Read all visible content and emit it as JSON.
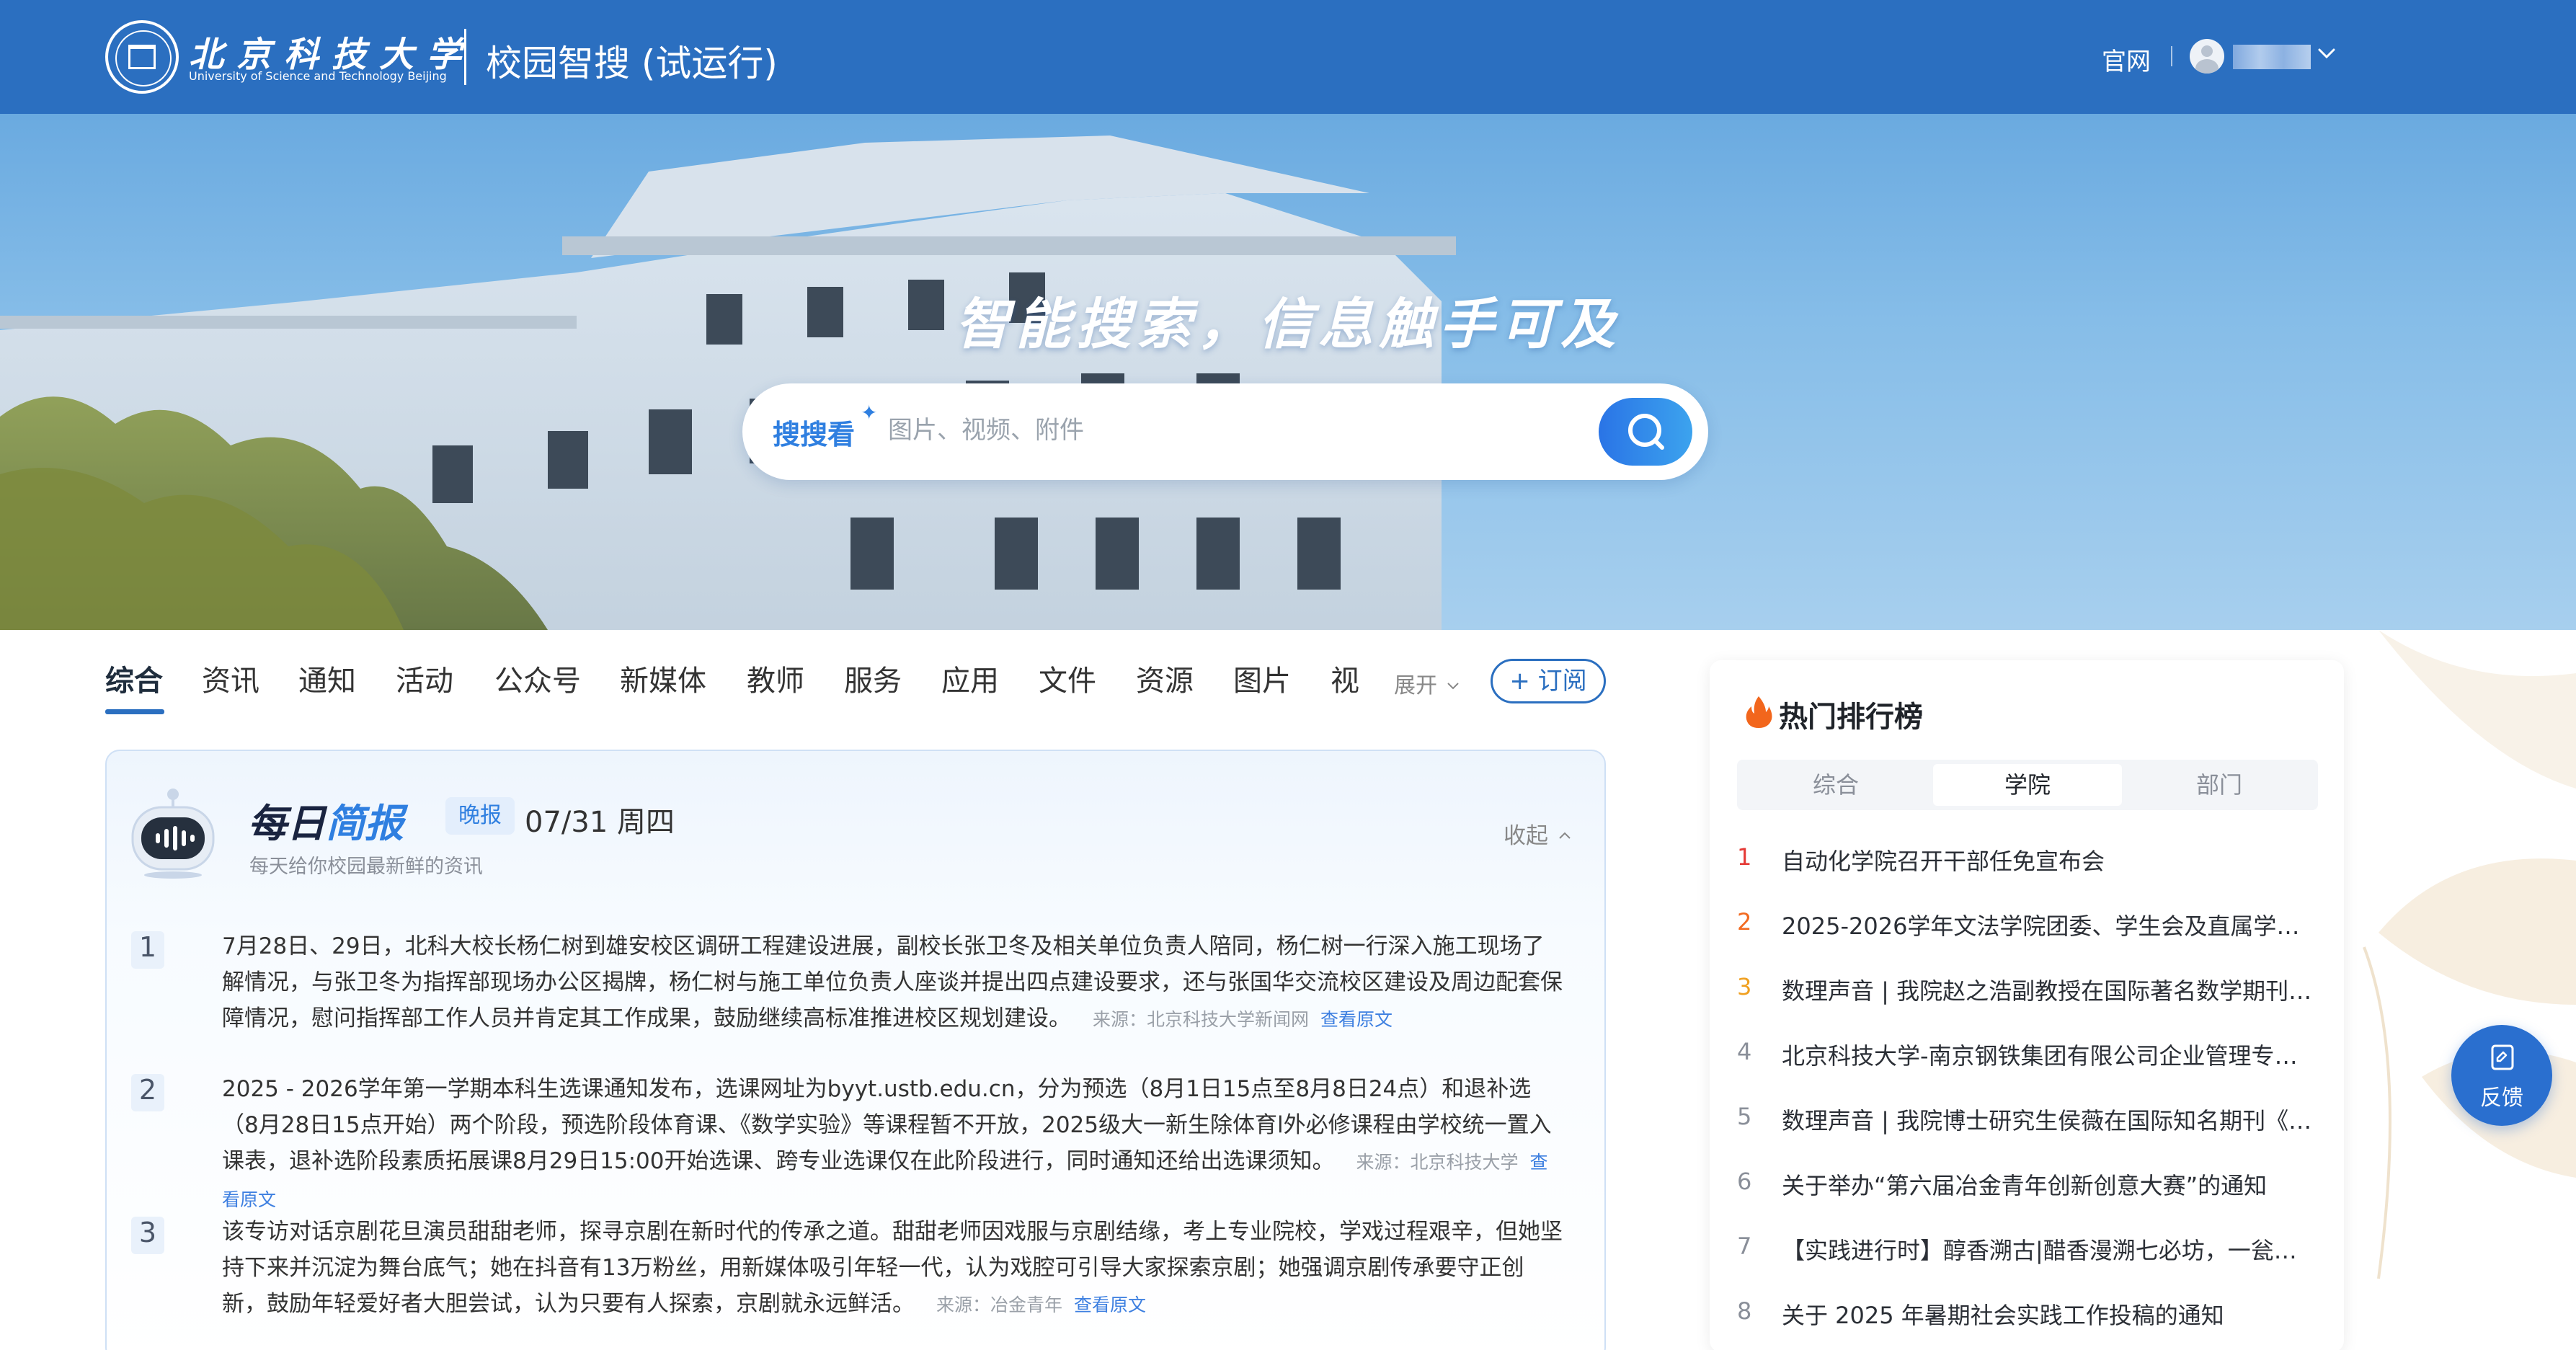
{
  "header": {
    "logo_cn": "北京科技大学",
    "logo_en": "University of Science and Technology Beijing",
    "app_title": "校园智搜 (试运行)",
    "official_site": "官网",
    "bg_color": "#2b6fc0"
  },
  "hero": {
    "slogan": "智能搜索，信息触手可及",
    "search_label": "搜搜看",
    "search_placeholder": "图片、视频、附件"
  },
  "tabs": {
    "items": [
      "综合",
      "资讯",
      "通知",
      "活动",
      "公众号",
      "新媒体",
      "教师",
      "服务",
      "应用",
      "文件",
      "资源",
      "图片",
      "视"
    ],
    "active": "综合",
    "expand_label": "展开",
    "subscribe_label": "+ 订阅"
  },
  "brief": {
    "title_part1": "每日",
    "title_part2": "简报",
    "badge": "晚报",
    "date": "07/31 周四",
    "subtitle": "每天给你校园最新鲜的资讯",
    "collapse_label": "收起",
    "items": [
      {
        "num": "1",
        "text": "7月28日、29日，北科大校长杨仁树到雄安校区调研工程建设进展，副校长张卫冬及相关单位负责人陪同，杨仁树一行深入施工现场了解情况，与张卫冬为指挥部现场办公区揭牌，杨仁树与施工单位负责人座谈并提出四点建设要求，还与张国华交流校区建设及周边配套保障情况，慰问指挥部工作人员并肯定其工作成果，鼓励继续高标准推进校区规划建设。",
        "source": "来源：北京科技大学新闻网",
        "link": "查看原文"
      },
      {
        "num": "2",
        "text": "2025 - 2026学年第一学期本科生选课通知发布，选课网址为byyt.ustb.edu.cn，分为预选（8月1日15点至8月8日24点）和退补选（8月28日15点开始）两个阶段，预选阶段体育课、《数学实验》等课程暂不开放，2025级大一新生除体育l外必修课程由学校统一置入课表，退补选阶段素质拓展课8月29日15:00开始选课、跨专业选课仅在此阶段进行，同时通知还给出选课须知。",
        "source": "来源：北京科技大学",
        "link": "查看原文"
      },
      {
        "num": "3",
        "text": "该专访对话京剧花旦演员甜甜老师，探寻京剧在新时代的传承之道。甜甜老师因戏服与京剧结缘，考上专业院校，学戏过程艰辛，但她坚持下来并沉淀为舞台底气；她在抖音有13万粉丝，用新媒体吸引年轻一代，认为戏腔可引导大家探索京剧；她强调京剧传承要守正创新，鼓励年轻爱好者大胆尝试，认为只要有人探索，京剧就永远鲜活。",
        "source": "来源：冶金青年",
        "link": "查看原文"
      }
    ]
  },
  "ranking": {
    "title": "热门排行榜",
    "tabs": [
      "综合",
      "学院",
      "部门"
    ],
    "active_tab": "学院",
    "num_colors": [
      "#e53935",
      "#f26b21",
      "#f0a020"
    ],
    "items": [
      {
        "num": "1",
        "text": "自动化学院召开干部任免宣布会"
      },
      {
        "num": "2",
        "text": "2025-2026学年文法学院团委、学生会及直属学生…"
      },
      {
        "num": "3",
        "text": "数理声音 | 我院赵之浩副教授在国际著名数学期刊…"
      },
      {
        "num": "4",
        "text": "北京科技大学-南京钢铁集团有限公司企业管理专业…"
      },
      {
        "num": "5",
        "text": "数理声音 | 我院博士研究生侯薇在国际知名期刊《…"
      },
      {
        "num": "6",
        "text": "关于举办“第六届冶金青年创新创意大赛”的通知"
      },
      {
        "num": "7",
        "text": "【实践进行时】醇香溯古|醋香漫溯七必坊，一瓮苦…"
      },
      {
        "num": "8",
        "text": "关于 2025 年暑期社会实践工作投稿的通知"
      }
    ]
  },
  "feedback": {
    "label": "反馈"
  }
}
